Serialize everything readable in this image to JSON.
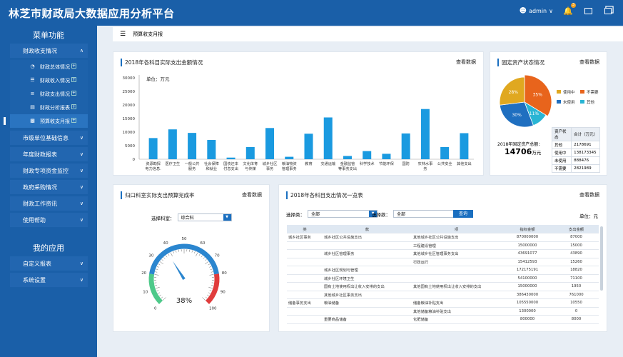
{
  "app": {
    "title": "林芝市财政局大数据应用分析平台",
    "user": "admin",
    "notif_count": "3"
  },
  "sidebar": {
    "menu_title": "菜单功能",
    "groups": [
      {
        "label": "财政收支情况"
      },
      {
        "label": "市级单位基础信息"
      },
      {
        "label": "年度财政报表"
      },
      {
        "label": "财政专项资金监控"
      },
      {
        "label": "政府采购情况"
      },
      {
        "label": "财政工作资讯"
      },
      {
        "label": "使用帮助"
      }
    ],
    "subs": [
      {
        "label": "财政总体情况",
        "icon": "pie-icon"
      },
      {
        "label": "财政收入情况",
        "icon": "list-icon"
      },
      {
        "label": "财政支出情况",
        "icon": "sliders-icon"
      },
      {
        "label": "财政分析报表",
        "icon": "report-icon"
      },
      {
        "label": "预算收支月报",
        "icon": "bar-icon"
      }
    ],
    "my_title": "我的应用",
    "my_items": [
      {
        "label": "自定义报表"
      },
      {
        "label": "系统设置"
      }
    ]
  },
  "breadcrumb": "预算收支月报",
  "card1": {
    "title": "2018年各科目实际支出金额情况",
    "more": "查看数据",
    "unit": "单位：万元"
  },
  "card2": {
    "title": "固定资产状态情况",
    "more": "查看数据",
    "legend": [
      "使用中",
      "不需要",
      "未使用",
      "其他"
    ],
    "pie_labels": [
      "35%",
      "28%",
      "30%",
      "11%"
    ],
    "total_label": "2018年固定资产总额：",
    "total_value": "14706",
    "total_unit": "万元",
    "table": [
      [
        "资产状态",
        "合计（万元）"
      ],
      [
        "其他",
        "2178691"
      ],
      [
        "使用中",
        "138173345"
      ],
      [
        "未使用",
        "888476"
      ],
      [
        "不需要",
        "2821989"
      ]
    ],
    "colors": [
      "#e8641c",
      "#29b5d4",
      "#1f6fc0",
      "#e0a820"
    ]
  },
  "card3": {
    "title": "归口科室实际支出预算完成率",
    "more": "查看数据",
    "select_label": "选择科室：",
    "select_value": "综合科",
    "value": "38%",
    "value_num": 38,
    "ticks": [
      "0",
      "10",
      "20",
      "30",
      "40",
      "50",
      "60",
      "70",
      "80",
      "90",
      "100"
    ]
  },
  "card4": {
    "title": "2018年各科目支出情况一览表",
    "more": "查看数据",
    "f1_label": "选择类：",
    "f1_value": "全部",
    "f2_label": "选择款：",
    "f2_value": "全部",
    "btn": "查询",
    "unit": "单位：元",
    "headers": [
      "类",
      "款",
      "项",
      "指标金额",
      "支出金额"
    ],
    "rows": [
      [
        "城乡社区事务",
        "城乡社区公共设施支出",
        "其他城乡社区公共设施支出",
        "870000000",
        "87000"
      ],
      [
        "",
        "",
        "工程建设管理",
        "15000000",
        "15000"
      ],
      [
        "",
        "城乡社区管理事务",
        "其他城乡社区管理事务支出",
        "43691077",
        "43890"
      ],
      [
        "",
        "",
        "行政运行",
        "15412593",
        "15260"
      ],
      [
        "",
        "城乡社区规划与管理",
        "",
        "172175191",
        "18820"
      ],
      [
        "",
        "城乡社区环境卫生",
        "",
        "54100000",
        "71100"
      ],
      [
        "",
        "国有土地使用权出让收入安排的支出",
        "其他国有土地使用权出让收入安排的支出",
        "15000000",
        "1950"
      ],
      [
        "",
        "其他城乡社区事务支出",
        "",
        "386430000",
        "761000"
      ],
      [
        "储备事务支出",
        "粮油储备",
        "储备粮油补贴支出",
        "105550000",
        "10550"
      ],
      [
        "",
        "",
        "其他储备粮油补贴支出",
        "1300000",
        "0"
      ],
      [
        "",
        "重要商品储备",
        "化肥储备",
        "800000",
        "8000"
      ]
    ]
  },
  "chart_data": [
    {
      "type": "bar",
      "title": "2018年各科目实际支出金额情况",
      "ylabel": "单位：万元",
      "ylim": [
        0,
        30000
      ],
      "yticks": [
        "0",
        "5000",
        "10000",
        "15000",
        "20000",
        "25000",
        "30000"
      ],
      "categories": [
        "资源勘探电力信息...",
        "医疗卫生",
        "一般公共服务",
        "社会保障和就业",
        "国债还本付息支出",
        "文化体育与传媒",
        "城乡社区事务",
        "粮油物资管理事务",
        "教育",
        "交通运输",
        "金融监管等事务支出",
        "科学技术",
        "节能环保",
        "国防",
        "农林水事务",
        "公共安全",
        "其他支出"
      ],
      "values": [
        7800,
        11000,
        9700,
        7100,
        600,
        4500,
        11500,
        900,
        9400,
        15400,
        1200,
        3000,
        2000,
        9500,
        18500,
        4500,
        9600
      ]
    },
    {
      "type": "pie",
      "title": "固定资产状态情况",
      "categories": [
        "不需要",
        "使用中",
        "未使用",
        "其他"
      ],
      "values": [
        35,
        28,
        30,
        11
      ]
    }
  ]
}
